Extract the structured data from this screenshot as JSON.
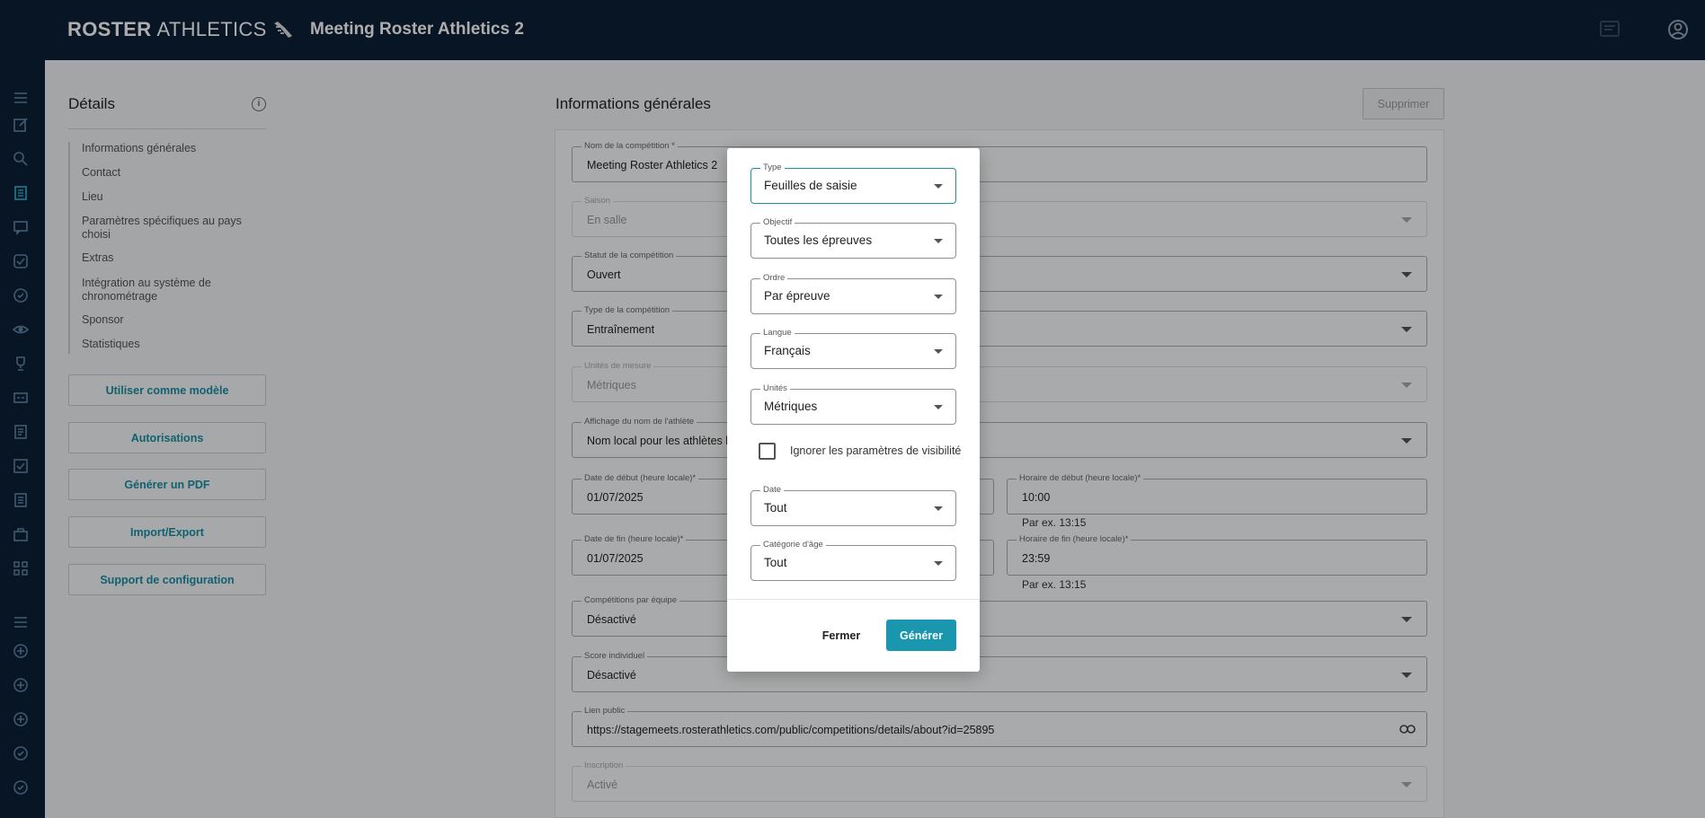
{
  "app": {
    "logo_bold": "ROSTER",
    "logo_light": "ATHLETICS",
    "page_title": "Meeting Roster Athletics 2"
  },
  "left_panel": {
    "title": "Détails",
    "nav": [
      "Informations générales",
      "Contact",
      "Lieu",
      "Paramètres spécifiques au pays choisi",
      "Extras",
      "Intégration au système de chronométrage",
      "Sponsor",
      "Statistiques"
    ],
    "buttons": [
      "Utiliser comme modèle",
      "Autorisations",
      "Générer un PDF",
      "Import/Export",
      "Support de configuration"
    ]
  },
  "main": {
    "title": "Informations générales",
    "delete_label": "Supprimer",
    "fields": {
      "name": {
        "label": "Nom de la compétition *",
        "value": "Meeting Roster Athletics 2"
      },
      "season": {
        "label": "Saison",
        "value": "En salle"
      },
      "status": {
        "label": "Statut de la compétition",
        "value": "Ouvert"
      },
      "type": {
        "label": "Type de la compétition",
        "value": "Entraînement"
      },
      "units": {
        "label": "Unités de mesure",
        "value": "Métriques"
      },
      "display_name": {
        "label": "Affichage du nom de l'athlète",
        "value": "Nom local pour les athlètes lo"
      },
      "start_date": {
        "label": "Date de début (heure locale)*",
        "value": "01/07/2025"
      },
      "start_time": {
        "label": "Horaire de début (heure locale)*",
        "value": "10:00",
        "hint": "Par ex. 13:15"
      },
      "end_date": {
        "label": "Date de fin (heure locale)*",
        "value": "01/07/2025"
      },
      "end_time": {
        "label": "Horaire de fin (heure locale)*",
        "value": "23:59",
        "hint": "Par ex. 13:15"
      },
      "team": {
        "label": "Compétitions par équipe",
        "value": "Désactivé"
      },
      "score": {
        "label": "Score individuel",
        "value": "Désactivé"
      },
      "public_link": {
        "label": "Lien public",
        "value": "https://stagemeets.rosterathletics.com/public/competitions/details/about?id=25895"
      },
      "registration": {
        "label": "Inscription",
        "value": "Activé"
      }
    }
  },
  "modal": {
    "type": {
      "label": "Type",
      "value": "Feuilles de saisie"
    },
    "objective": {
      "label": "Objectif",
      "value": "Toutes les épreuves"
    },
    "order": {
      "label": "Ordre",
      "value": "Par épreuve"
    },
    "language": {
      "label": "Langue",
      "value": "Français"
    },
    "units": {
      "label": "Unités",
      "value": "Métriques"
    },
    "ignore_visibility": {
      "label": "Ignorer les paramètres de visibilité",
      "checked": false
    },
    "date": {
      "label": "Date",
      "value": "Tout"
    },
    "age_category": {
      "label": "Catégorie d'âge",
      "value": "Tout"
    },
    "close_label": "Fermer",
    "generate_label": "Générer"
  },
  "colors": {
    "topbar": "#0d2036",
    "accent": "#1a96ae"
  }
}
